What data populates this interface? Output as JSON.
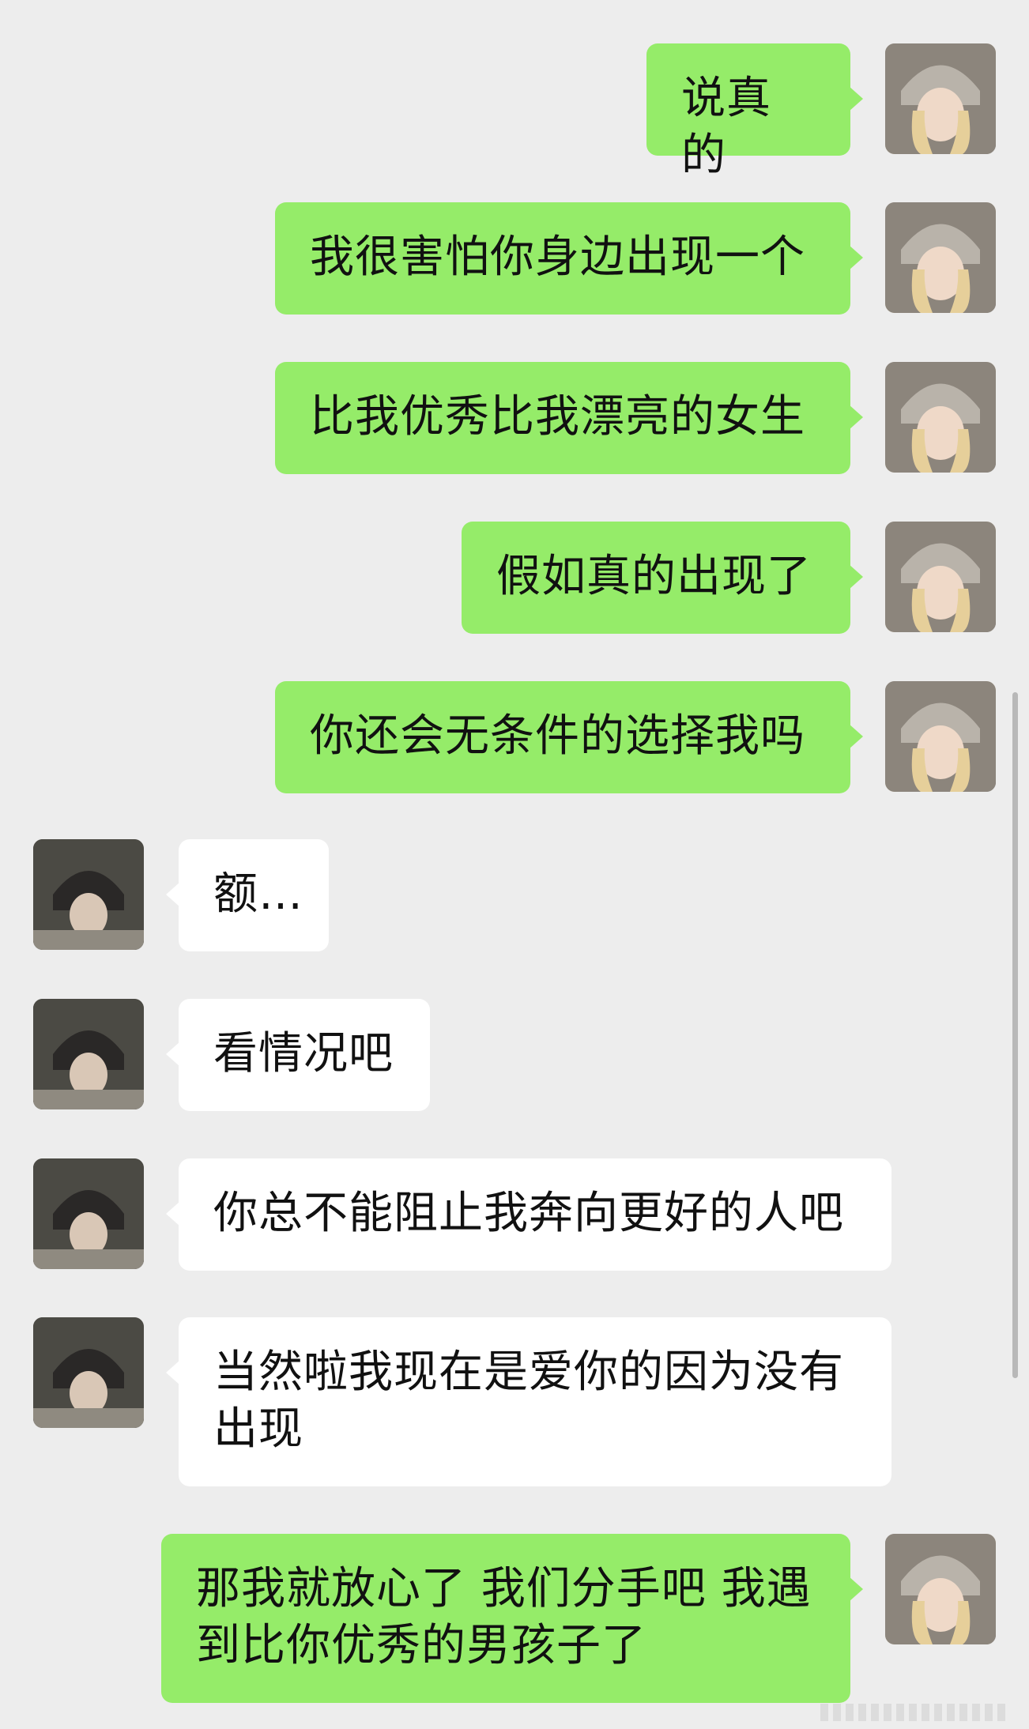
{
  "chat": {
    "messages": [
      {
        "from": "me",
        "text": "说真的"
      },
      {
        "from": "me",
        "text": "我很害怕你身边出现一个"
      },
      {
        "from": "me",
        "text": "比我优秀比我漂亮的女生"
      },
      {
        "from": "me",
        "text": "假如真的出现了"
      },
      {
        "from": "me",
        "text": "你还会无条件的选择我吗"
      },
      {
        "from": "them",
        "text": "额…"
      },
      {
        "from": "them",
        "text": "看情况吧"
      },
      {
        "from": "them",
        "text": "你总不能阻止我奔向更好的人吧"
      },
      {
        "from": "them",
        "text": "当然啦我现在是爱你的因为没有出现"
      },
      {
        "from": "me",
        "text": "那我就放心了 我们分手吧 我遇到比你优秀的男孩子了"
      }
    ]
  },
  "colors": {
    "background": "#ededed",
    "outgoing_bubble": "#95ec69",
    "incoming_bubble": "#ffffff"
  },
  "icons": {
    "me_avatar": "avatar-photo-girl",
    "them_avatar": "avatar-photo-boy"
  }
}
